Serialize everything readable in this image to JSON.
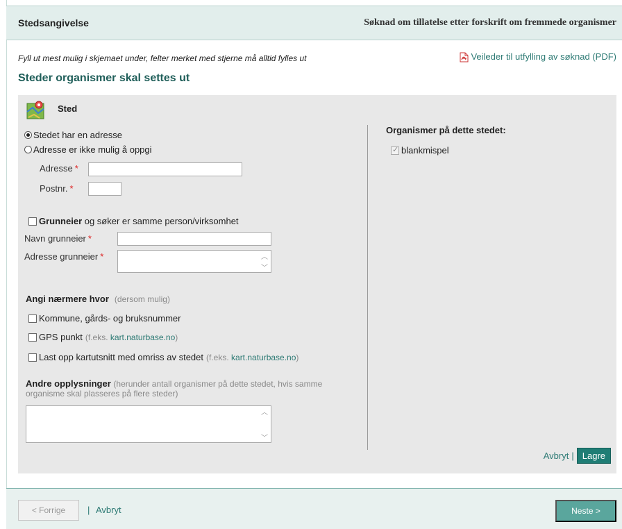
{
  "header": {
    "left_title": "Stedsangivelse",
    "right_title": "Søknad om tillatelse etter forskrift om fremmede organismer"
  },
  "instructions": "Fyll ut mest mulig i skjemaet under, felter merket med stjerne må alltid fylles ut",
  "pdf_link": "Veileder til utfylling av søknad (PDF)",
  "section_title": "Steder organismer skal settes ut",
  "panel": {
    "heading": "Sted",
    "address_options": {
      "option1": "Stedet har en adresse",
      "option2": "Adresse er ikke mulig å oppgi",
      "selected": "Stedet har en adresse"
    },
    "address_label": "Adresse",
    "postnr_label": "Postnr.",
    "required_mark": "*",
    "same_owner_bold": "Grunneier",
    "same_owner_rest": " og søker er samme person/virksomhet",
    "owner_name_label": "Navn grunneier",
    "owner_address_label": "Adresse grunneier",
    "specify_title": "Angi nærmere hvor",
    "specify_hint": "(dersom mulig)",
    "option_kommune": "Kommune, gårds- og bruksnummer",
    "option_gps": "GPS punkt",
    "option_gps_hint_pre": "(f.eks. ",
    "option_gps_link": "kart.naturbase.no",
    "option_gps_hint_post": ")",
    "option_upload": "Last opp kartutsnitt med omriss av stedet",
    "option_upload_hint_pre": "(f.eks. ",
    "option_upload_link": "kart.naturbase.no",
    "option_upload_hint_post": ")",
    "other_title": "Andre opplysninger",
    "other_hint_line1": "(herunder antall organismer på dette stedet, hvis samme",
    "other_hint_line2": "organisme skal plasseres på flere steder)",
    "organisms_title": "Organismer på dette stedet:",
    "organism_1": "blankmispel",
    "cancel": "Avbryt",
    "separator": "|",
    "save": "Lagre"
  },
  "footer": {
    "prev": "< Forrige",
    "separator": "|",
    "cancel": "Avbryt",
    "next": "Neste >"
  },
  "colors": {
    "accent": "#1f7d75",
    "link": "#2d7a74",
    "header_bg": "#e2eeec",
    "panel_bg": "#e8e8e8",
    "required": "#dd2222"
  },
  "icons": {
    "pdf": "pdf-icon",
    "sted": "map-marker-icon"
  }
}
